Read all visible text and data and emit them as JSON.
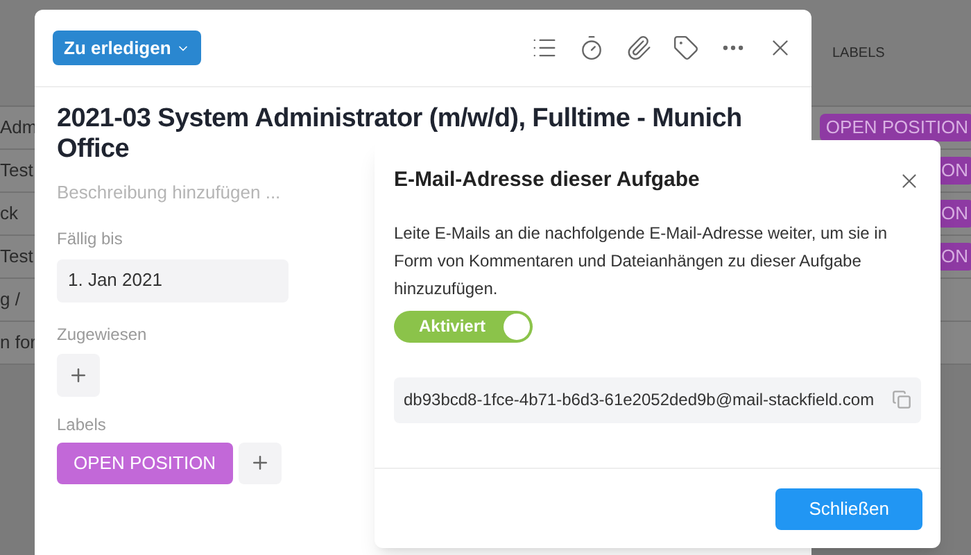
{
  "background_table": {
    "column_label": "LABELS",
    "rows": [
      {
        "cell_1": "Adm",
        "label": "OPEN POSITION"
      },
      {
        "cell_1": "Test",
        "label": "ON"
      },
      {
        "cell_1": "ck",
        "label": "ON"
      },
      {
        "cell_1": "Test",
        "label": "ON"
      },
      {
        "cell_1": "g /"
      },
      {
        "cell_1": "n for"
      }
    ]
  },
  "task": {
    "status_button": "Zu erledigen",
    "title": "2021-03 System Administrator (m/w/d), Fulltime - Munich Office",
    "description": {
      "placeholder": "Beschreibung hinzufügen ..."
    },
    "due_label": "Fällig bis",
    "due_value": "1. Jan 2021",
    "assigned_label": "Zugewiesen",
    "labels_label": "Labels",
    "labels": [
      {
        "text": "OPEN POSITION",
        "color": "#c268d8"
      }
    ]
  },
  "email_dialog": {
    "title": "E-Mail-Adresse dieser Aufgabe",
    "text": "Leite E-Mails an die nachfolgende E-Mail-Adresse weiter, um sie in Form von Kommentaren und Dateianhängen zu dieser Aufgabe hinzuzufügen.",
    "toggle": {
      "label": "Aktiviert",
      "on": true
    },
    "email": "db93bcd8-1fce-4b71-b6d3-61e2052ded9b@mail-stackfield.com",
    "close_button": "Schließen"
  }
}
